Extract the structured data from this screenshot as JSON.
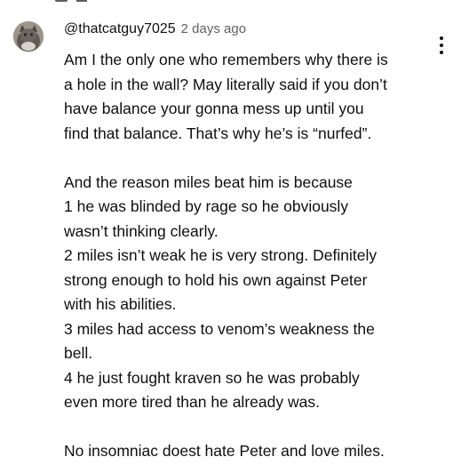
{
  "comment": {
    "author": "@thatcatguy7025",
    "timestamp": "2 days ago",
    "lines": [
      "Am I the only one who remembers why there is",
      "a hole in the wall? May literally said if you don’t",
      "have balance your gonna mess up until you",
      "find that balance. That’s why he’s is “nurfed”.",
      "",
      "And the reason miles beat him is because",
      "1 he was blinded by rage so he obviously",
      "wasn’t thinking clearly.",
      "2 miles isn’t weak he is very strong. Definitely",
      "strong enough to hold his own against Peter",
      "with his abilities.",
      "3 miles had access to venom’s weakness the",
      "bell.",
      "4 he just fought kraven so he was probably",
      "even more tired than he already was.",
      "",
      "No insomniac doest hate Peter and love miles."
    ]
  },
  "icons": {
    "menu": "more-vertical-icon",
    "avatar": "cat-avatar"
  },
  "colors": {
    "text": "#0f0f0f",
    "secondary": "#606060",
    "background": "#ffffff"
  }
}
